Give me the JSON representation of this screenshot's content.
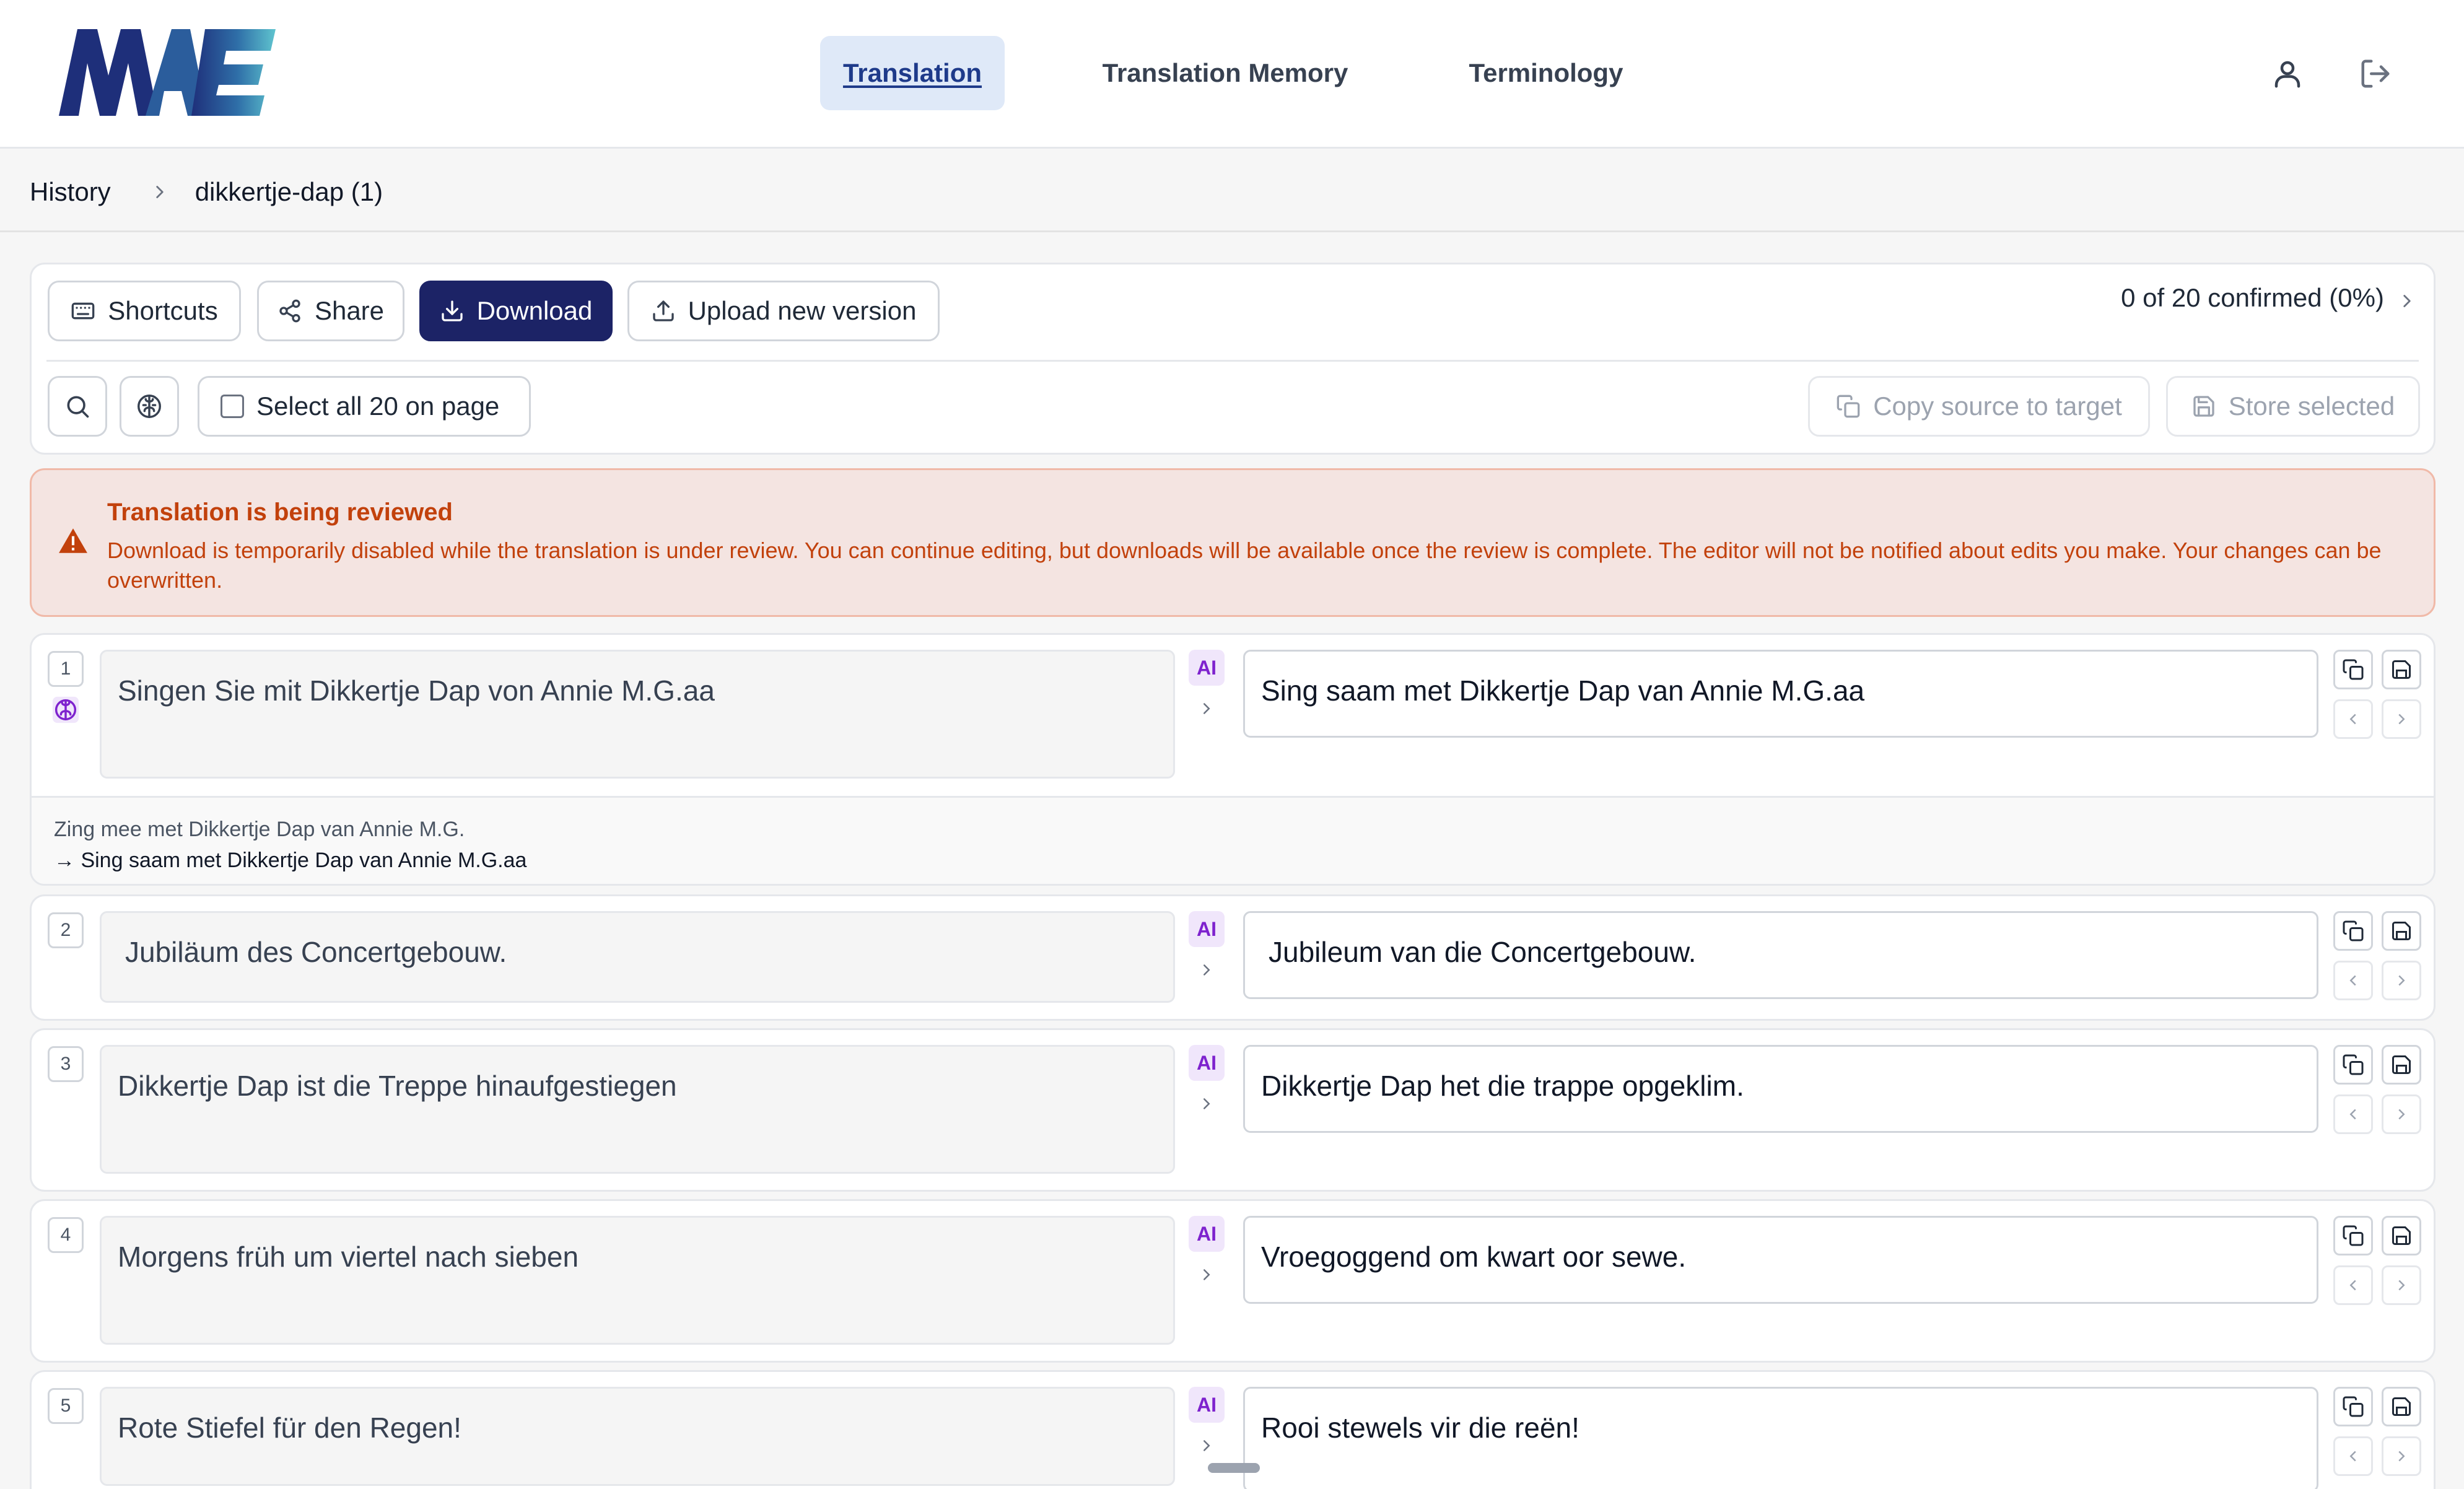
{
  "app": {
    "logo_text": "MAE",
    "nav": [
      {
        "label": "Translation",
        "active": true
      },
      {
        "label": "Translation Memory",
        "active": false
      },
      {
        "label": "Terminology",
        "active": false
      }
    ],
    "icons": {
      "profile": "user-icon",
      "logout": "logout-icon"
    }
  },
  "breadcrumb": {
    "root": "History",
    "current": "dikkertje-dap (1)"
  },
  "toolbar": {
    "shortcuts": "Shortcuts",
    "share": "Share",
    "download": "Download",
    "upload": "Upload new version",
    "progress": "0 of 20 confirmed (0%)",
    "select_all": "Select all 20 on page",
    "copy_source": "Copy source to target",
    "store_selected": "Store selected"
  },
  "alert": {
    "title": "Translation is being reviewed",
    "body": "Download is temporarily disabled while the translation is under review. You can continue editing, but downloads will be available once the review is complete. The editor will not be notified about edits you make. Your changes can be overwritten."
  },
  "segments": [
    {
      "number": "1",
      "source": "Singen Sie mit Dikkertje Dap von Annie M.G.aa",
      "badge": "AI",
      "target": "Sing saam met Dikkertje Dap van Annie M.G.aa",
      "tm_source": "Zing mee met Dikkertje Dap van Annie M.G.",
      "tm_target": "→ Sing saam met Dikkertje Dap van Annie M.G.aa"
    },
    {
      "number": "2",
      "source": "Jubiläum des Concertgebouw.",
      "badge": "AI",
      "target": "Jubileum van die Concertgebouw."
    },
    {
      "number": "3",
      "source": "Dikkertje Dap ist die Treppe hinaufgestiegen",
      "badge": "AI",
      "target": "Dikkertje Dap het die trappe opgeklim."
    },
    {
      "number": "4",
      "source": "Morgens früh um viertel nach sieben",
      "badge": "AI",
      "target": "Vroegoggend om kwart oor sewe."
    },
    {
      "number": "5",
      "source": "Rote Stiefel für den Regen!",
      "badge": "AI",
      "target": "Rooi stewels vir die reën!"
    }
  ],
  "colors": {
    "primary": "#1c2366",
    "nav_active_bg": "#dfe9f8",
    "alert_bg": "#f4e4e1",
    "alert_text": "#c2410c",
    "ai_badge": "#7e22ce"
  }
}
